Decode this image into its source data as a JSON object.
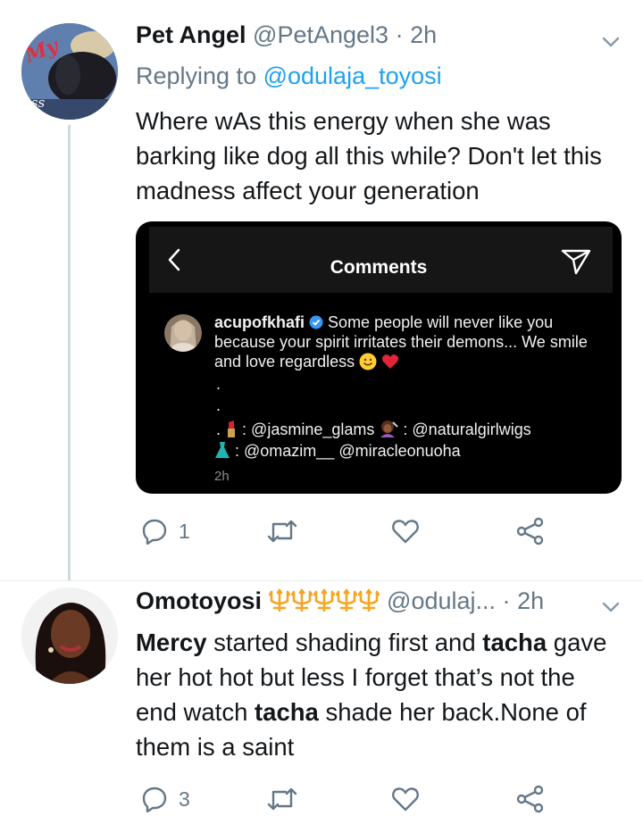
{
  "colors": {
    "link": "#1da1f2",
    "muted": "#657786",
    "thread_line": "#cfd9de"
  },
  "tweets": [
    {
      "name": "Pet Angel",
      "handle": "@PetAngel3",
      "dot": "·",
      "time": "2h",
      "reply_prefix": "Replying to ",
      "reply_handle": "@odulaja_toyosi",
      "avatar_text": [
        "My",
        "Ass"
      ],
      "text": "Where wAs this energy when she was barking like dog all this while? Don't let this madness affect your generation",
      "actions": {
        "reply_count": "1",
        "retweet_count": "",
        "like_count": ""
      },
      "embed": {
        "title": "Comments",
        "username": "acupofkhafi",
        "comment": "Some people will never like you because your spirit irritates their demons... We smile and love regardless",
        "dot1": ".",
        "dot2": ".",
        "dot3": ".",
        "line1_a": ": @jasmine_glams",
        "line1_b": ": @naturalgirlwigs",
        "line2": ": @omazim__ @miracleonuoha",
        "time": "2h"
      }
    },
    {
      "name": "Omotoyosi",
      "handle": "@odulaj...",
      "dot": "·",
      "time": "2h",
      "text_parts": [
        {
          "t": "Mercy",
          "b": true
        },
        {
          "t": " started shading first and ",
          "b": false
        },
        {
          "t": "tacha",
          "b": true
        },
        {
          "t": " gave her hot hot but less I forget that’s not the end watch ",
          "b": false
        },
        {
          "t": "tacha",
          "b": true
        },
        {
          "t": " shade her back.None of them is a saint",
          "b": false
        }
      ],
      "actions": {
        "reply_count": "3",
        "retweet_count": "",
        "like_count": ""
      }
    }
  ]
}
